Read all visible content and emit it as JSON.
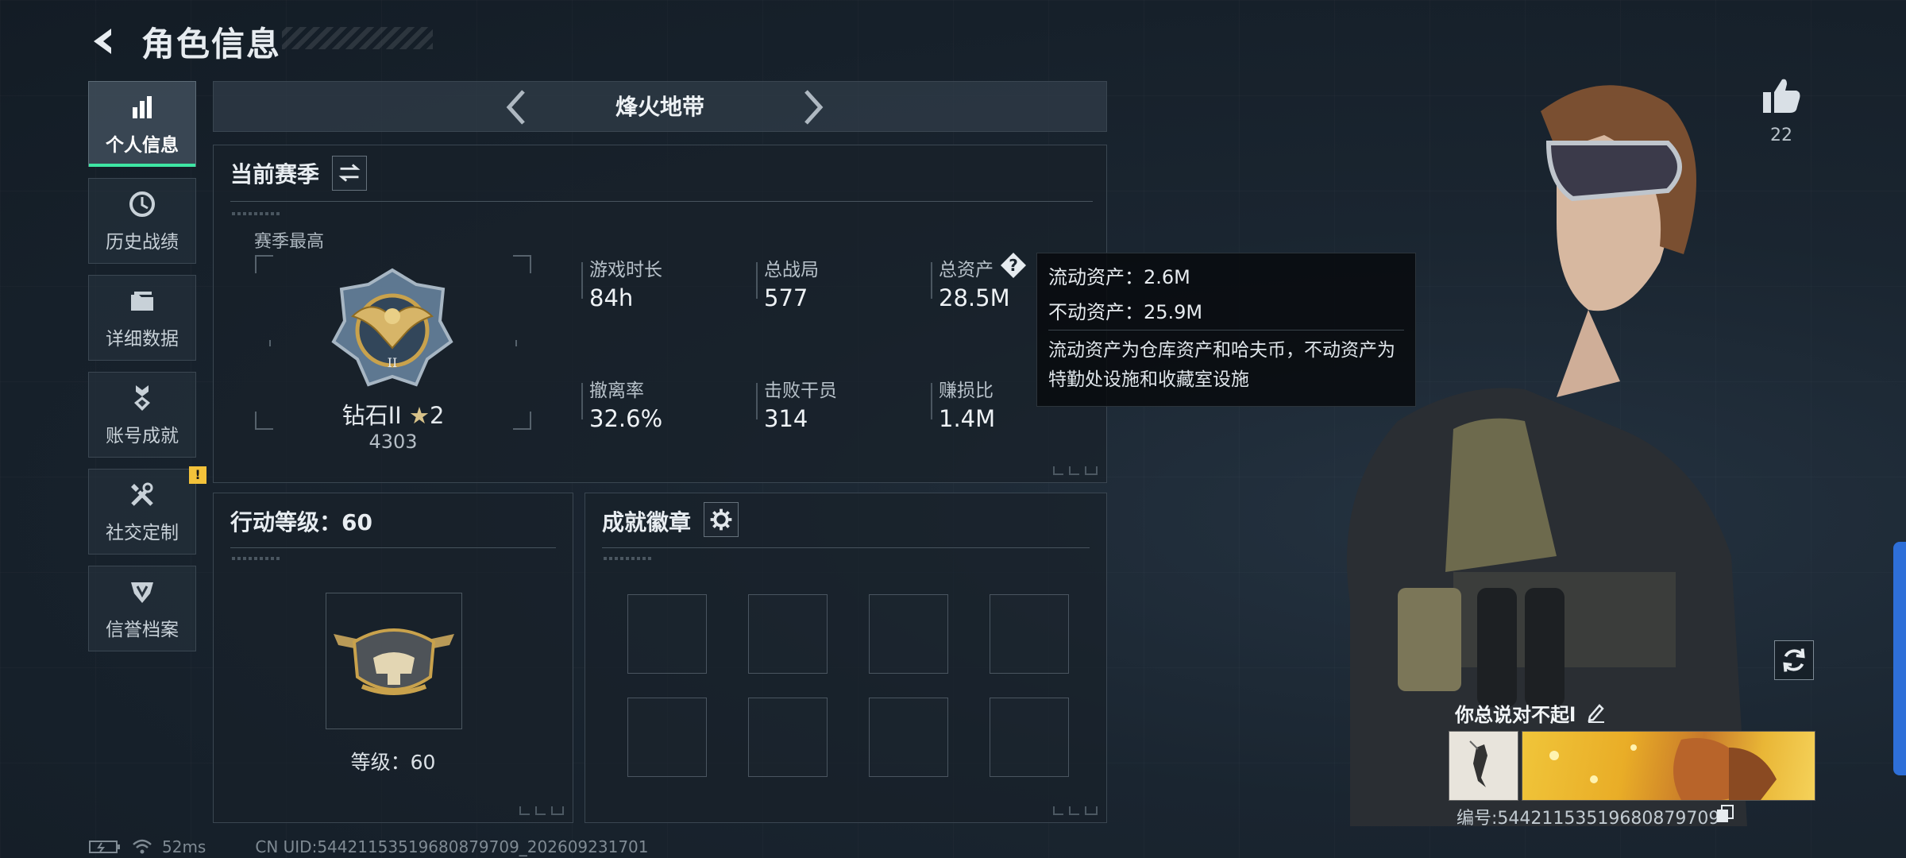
{
  "header": {
    "title": "角色信息"
  },
  "sidebar": {
    "items": [
      {
        "label": "个人信息",
        "icon": "bar-chart-icon",
        "active": true
      },
      {
        "label": "历史战绩",
        "icon": "history-clock-icon"
      },
      {
        "label": "详细数据",
        "icon": "folder-icon"
      },
      {
        "label": "账号成就",
        "icon": "medal-icon"
      },
      {
        "label": "社交定制",
        "icon": "tools-icon",
        "badge": "!"
      },
      {
        "label": "信誉档案",
        "icon": "shield-icon"
      }
    ]
  },
  "mode": {
    "title": "烽火地带"
  },
  "season": {
    "title": "当前赛季",
    "best_label": "赛季最高",
    "rank_name": "钻石II",
    "rank_stars": "2",
    "rank_score": "4303",
    "stats": [
      {
        "label": "游戏时长",
        "value": "84h"
      },
      {
        "label": "总战局",
        "value": "577"
      },
      {
        "label": "总资产",
        "value": "28.5M"
      },
      {
        "label": "撤离率",
        "value": "32.6%"
      },
      {
        "label": "击败干员",
        "value": "314"
      },
      {
        "label": "赚损比",
        "value": "1.4M"
      }
    ],
    "help_icon_text": "?"
  },
  "tooltip": {
    "liquid": "流动资产：2.6M",
    "fixed": "不动资产：25.9M",
    "desc": "流动资产为仓库资产和哈夫币，不动资产为特勤处设施和收藏室设施"
  },
  "level": {
    "title": "行动等级：60",
    "text": "等级：60"
  },
  "badges": {
    "title": "成就徽章"
  },
  "profile": {
    "likes": "22",
    "signature": "你总说对不起l",
    "uid_line": "编号:544211535196808797​09"
  },
  "status": {
    "ping": "52ms",
    "uid": "CN UID:544211535196808797​09_202609231701"
  },
  "colors": {
    "accent": "#3ee6a4",
    "warning": "#f3c23a",
    "edge": "#2e6fd8"
  }
}
